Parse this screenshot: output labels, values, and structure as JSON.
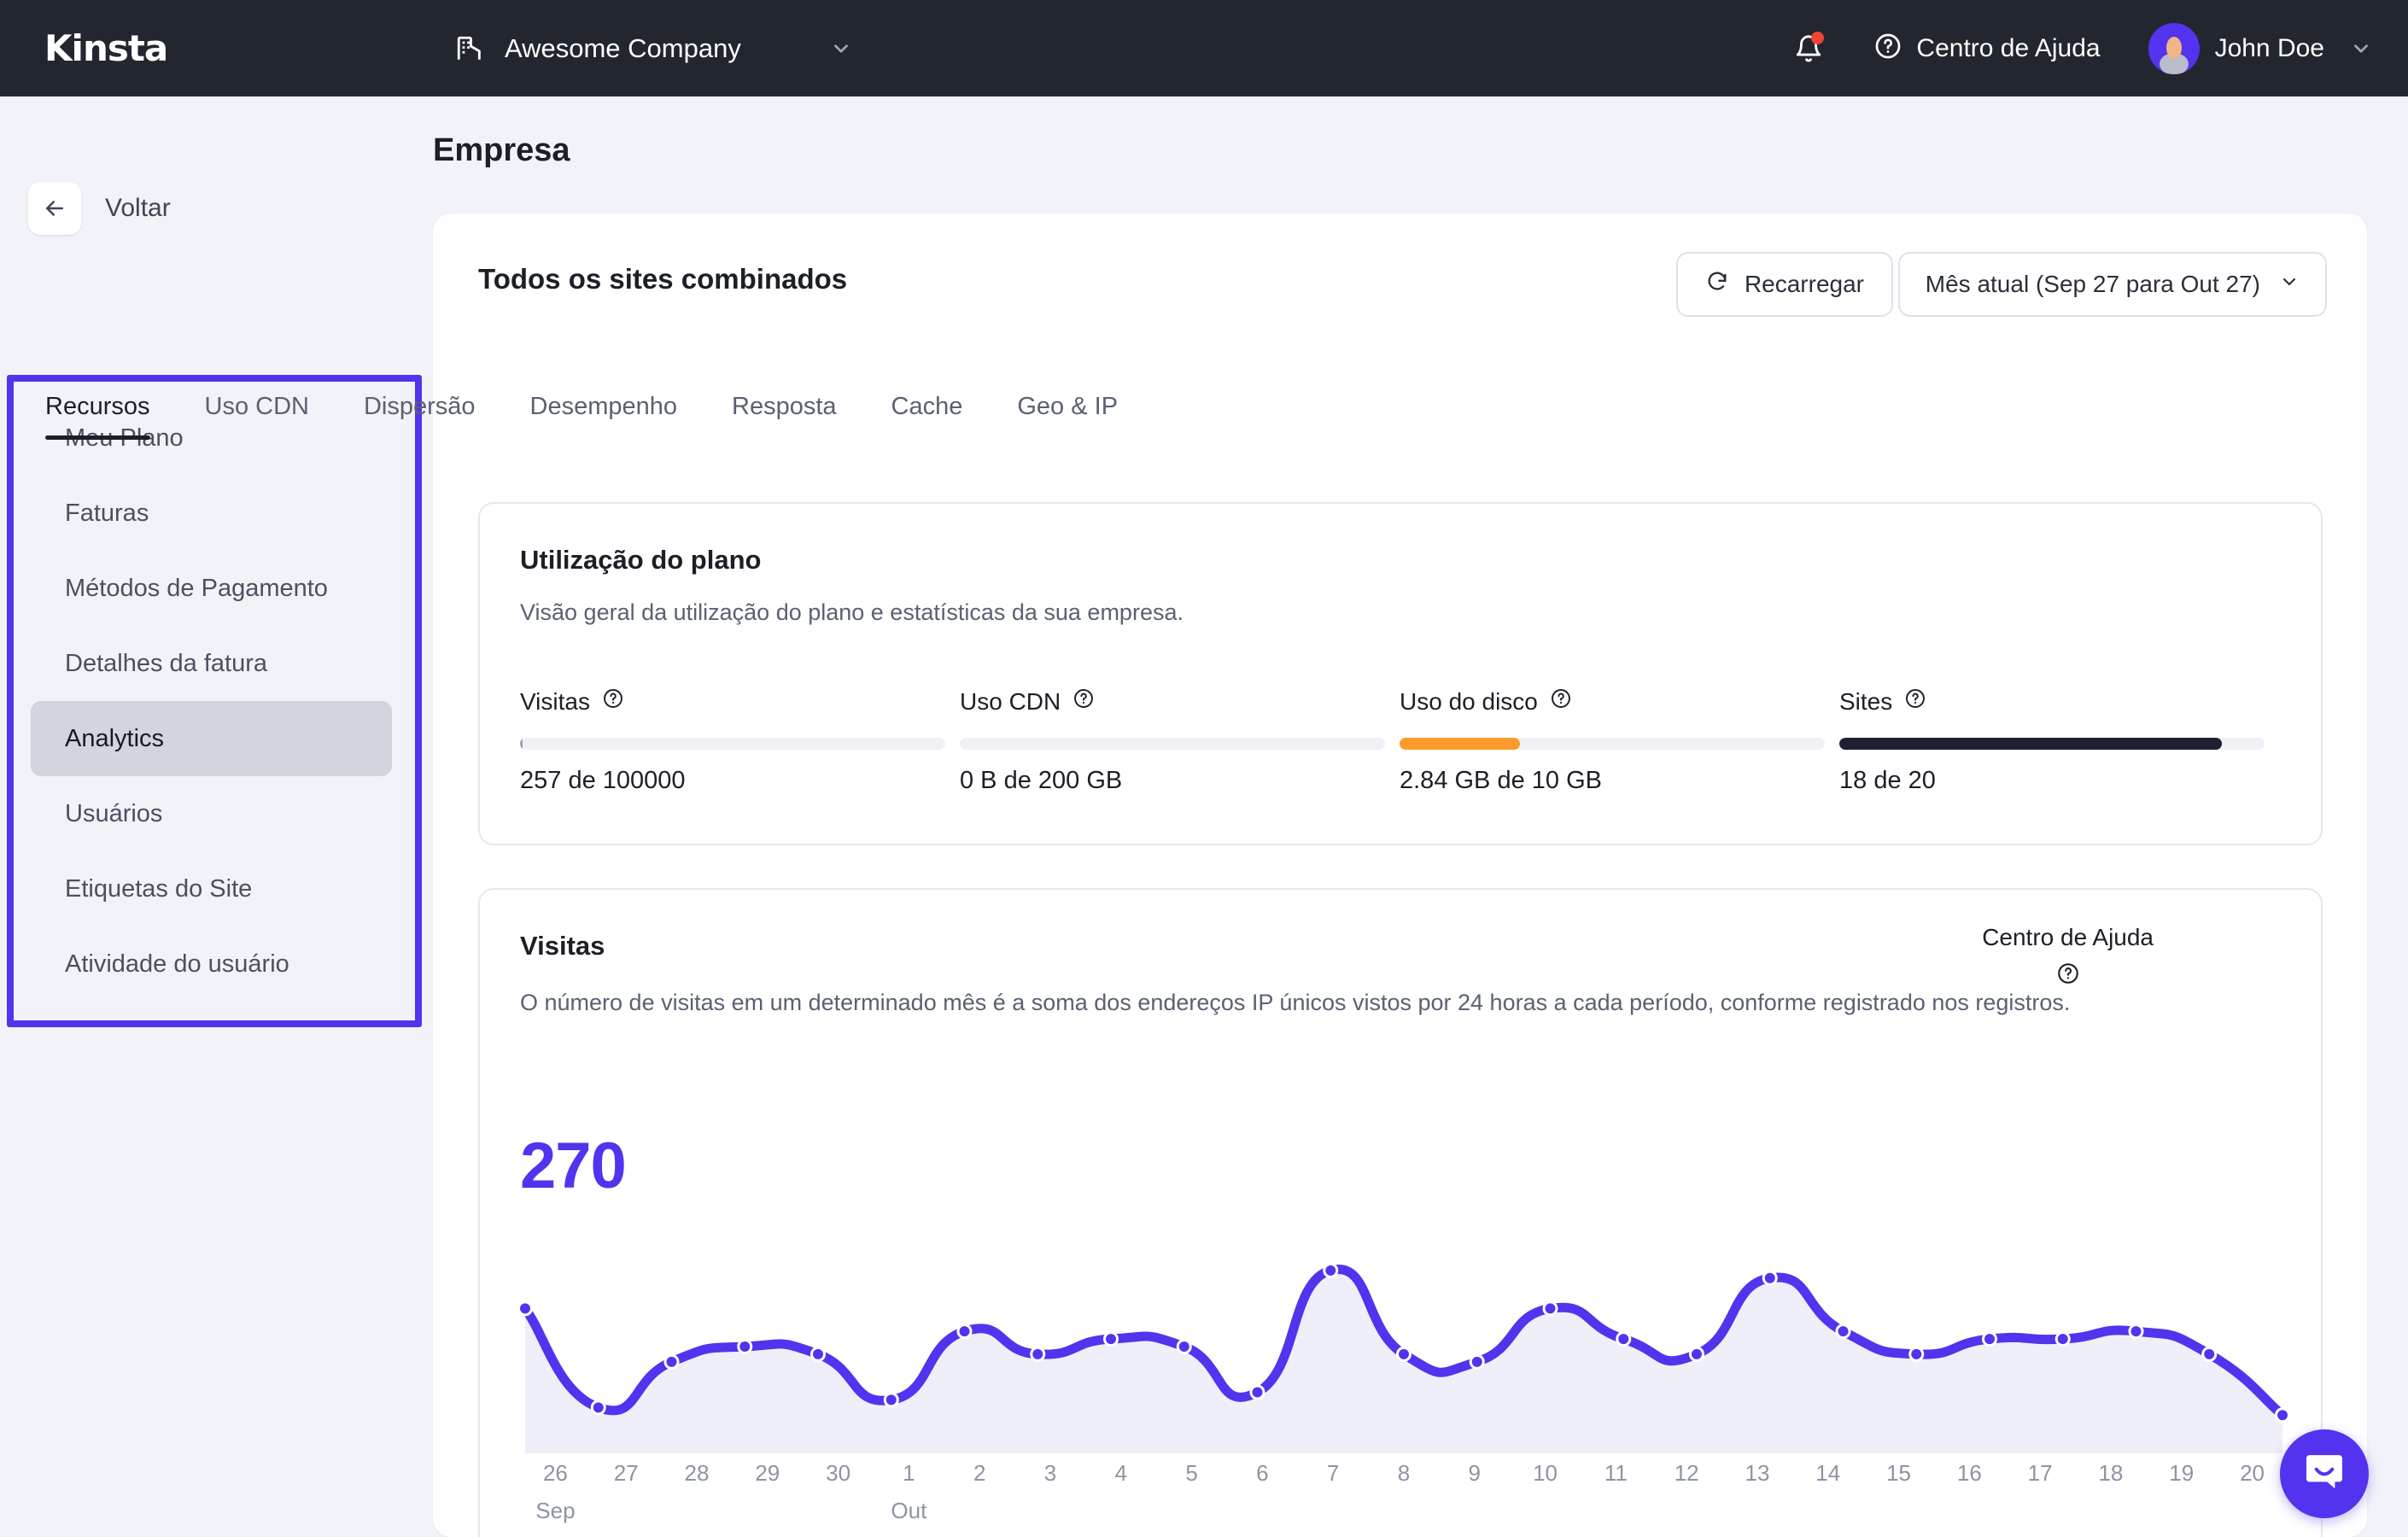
{
  "colors": {
    "accent_purple": "#5333ED",
    "topbar_bg": "#22262E",
    "page_bg": "#F2F3F8",
    "orange": "#FB9A2D",
    "dark_bar": "#1D2030",
    "notification_dot": "#F04438"
  },
  "topbar": {
    "logo": "Kinsta",
    "company": {
      "name": "Awesome Company",
      "icon": "building-icon",
      "chevron": "chevron-down-icon"
    },
    "notifications_icon": "bell-icon",
    "help": {
      "icon": "question-circle-icon",
      "label": "Centro de Ajuda"
    },
    "user": {
      "name": "John Doe",
      "avatar": "user-avatar",
      "chevron": "chevron-down-icon"
    }
  },
  "page": {
    "title": "Empresa"
  },
  "sidebar": {
    "back": {
      "icon": "arrow-left-icon",
      "label": "Voltar"
    },
    "items": [
      {
        "label": "Meu Plano",
        "active": false
      },
      {
        "label": "Faturas",
        "active": false
      },
      {
        "label": "Métodos de Pagamento",
        "active": false
      },
      {
        "label": "Detalhes da fatura",
        "active": false
      },
      {
        "label": "Analytics",
        "active": true
      },
      {
        "label": "Usuários",
        "active": false
      },
      {
        "label": "Etiquetas do Site",
        "active": false
      },
      {
        "label": "Atividade do usuário",
        "active": false
      }
    ]
  },
  "main": {
    "card_title": "Todos os sites combinados",
    "reload_button": {
      "label": "Recarregar",
      "icon": "refresh-icon"
    },
    "date_range": {
      "label": "Mês atual (Sep 27 para Out 27)",
      "icon": "chevron-down-icon"
    },
    "tabs": [
      {
        "label": "Recursos",
        "active": true
      },
      {
        "label": "Uso CDN",
        "active": false
      },
      {
        "label": "Dispersão",
        "active": false
      },
      {
        "label": "Desempenho",
        "active": false
      },
      {
        "label": "Resposta",
        "active": false
      },
      {
        "label": "Cache",
        "active": false
      },
      {
        "label": "Geo & IP",
        "active": false
      }
    ],
    "plan_usage": {
      "title": "Utilização do plano",
      "subtitle": "Visão geral da utilização do plano e estatísticas da sua empresa.",
      "stats": [
        {
          "label": "Visitas",
          "value": "257 de 100000",
          "percent": 0.3,
          "color": "#9AA0B0",
          "info_icon": "question-circle-icon"
        },
        {
          "label": "Uso CDN",
          "value": "0 B de 200 GB",
          "percent": 0,
          "color": "#9AA0B0",
          "info_icon": "question-circle-icon"
        },
        {
          "label": "Uso do disco",
          "value": "2.84 GB de 10 GB",
          "percent": 28.4,
          "color": "#FB9A2D",
          "info_icon": "question-circle-icon"
        },
        {
          "label": "Sites",
          "value": "18 de 20",
          "percent": 90,
          "color": "#1D2030",
          "info_icon": "question-circle-icon"
        }
      ]
    },
    "visits": {
      "title": "Visitas",
      "description": "O número de visitas em um determinado mês é a soma dos endereços IP únicos vistos por 24 horas a cada período, conforme registrado nos registros.",
      "help_label": "Centro de Ajuda",
      "help_icon": "question-circle-icon",
      "total": "270"
    }
  },
  "chat_widget": {
    "icon": "intercom-chat-icon"
  },
  "chart_data": {
    "type": "area",
    "title": "Visitas",
    "xlabel": "",
    "ylabel": "",
    "grid": false,
    "legend": "none",
    "line_color": "#5333ED",
    "fill_color": "#EEEFF8",
    "total_label": "270",
    "x": [
      "26",
      "27",
      "28",
      "29",
      "30",
      "1",
      "2",
      "3",
      "4",
      "5",
      "6",
      "7",
      "8",
      "9",
      "10",
      "11",
      "12",
      "13",
      "14",
      "15",
      "16",
      "17",
      "18",
      "19",
      "20"
    ],
    "month_labels": {
      "26": "Sep",
      "1": "Out"
    },
    "categories": [
      "26 Sep",
      "27 Sep",
      "28 Sep",
      "29 Sep",
      "30 Sep",
      "1 Out",
      "2 Out",
      "3 Out",
      "4 Out",
      "5 Out",
      "6 Out",
      "7 Out",
      "8 Out",
      "9 Out",
      "10 Out",
      "11 Out",
      "12 Out",
      "13 Out",
      "14 Out",
      "15 Out",
      "16 Out",
      "17 Out",
      "18 Out",
      "19 Out",
      "20 Out"
    ],
    "values": [
      17,
      4,
      10,
      12,
      11,
      5,
      14,
      11,
      13,
      12,
      6,
      22,
      11,
      10,
      17,
      13,
      11,
      21,
      14,
      11,
      13,
      13,
      14,
      11,
      3
    ],
    "ylim": [
      0,
      24
    ]
  }
}
